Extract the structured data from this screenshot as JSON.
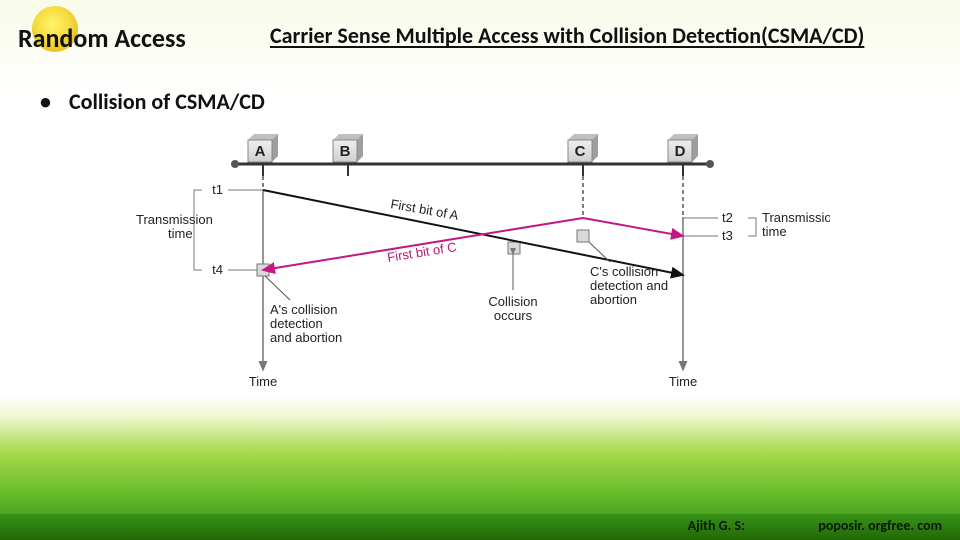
{
  "header": {
    "title": "Random Access",
    "subtitle": "Carrier Sense Multiple Access  with Collision Detection(CSMA/CD)"
  },
  "bullet": {
    "text": "Collision of  CSMA/CD"
  },
  "diagram": {
    "nodes": {
      "a": "A",
      "b": "B",
      "c": "C",
      "d": "D"
    },
    "times": {
      "t1": "t1",
      "t2": "t2",
      "t3": "t3",
      "t4": "t4"
    },
    "labels": {
      "transTimeLeft": "Transmission\ntime",
      "transTimeRight": "Transmission\ntime",
      "firstBitA": "First bit of A",
      "firstBitC": "First bit of C",
      "aAbort": "A's collision\ndetection\nand abortion",
      "cAbort": "C's collision\ndetection and\nabortion",
      "collision": "Collision\noccurs",
      "timeLeft": "Time",
      "timeRight": "Time"
    }
  },
  "footer": {
    "author": "Ajith G. S:",
    "site": "poposir. orgfree. com"
  }
}
